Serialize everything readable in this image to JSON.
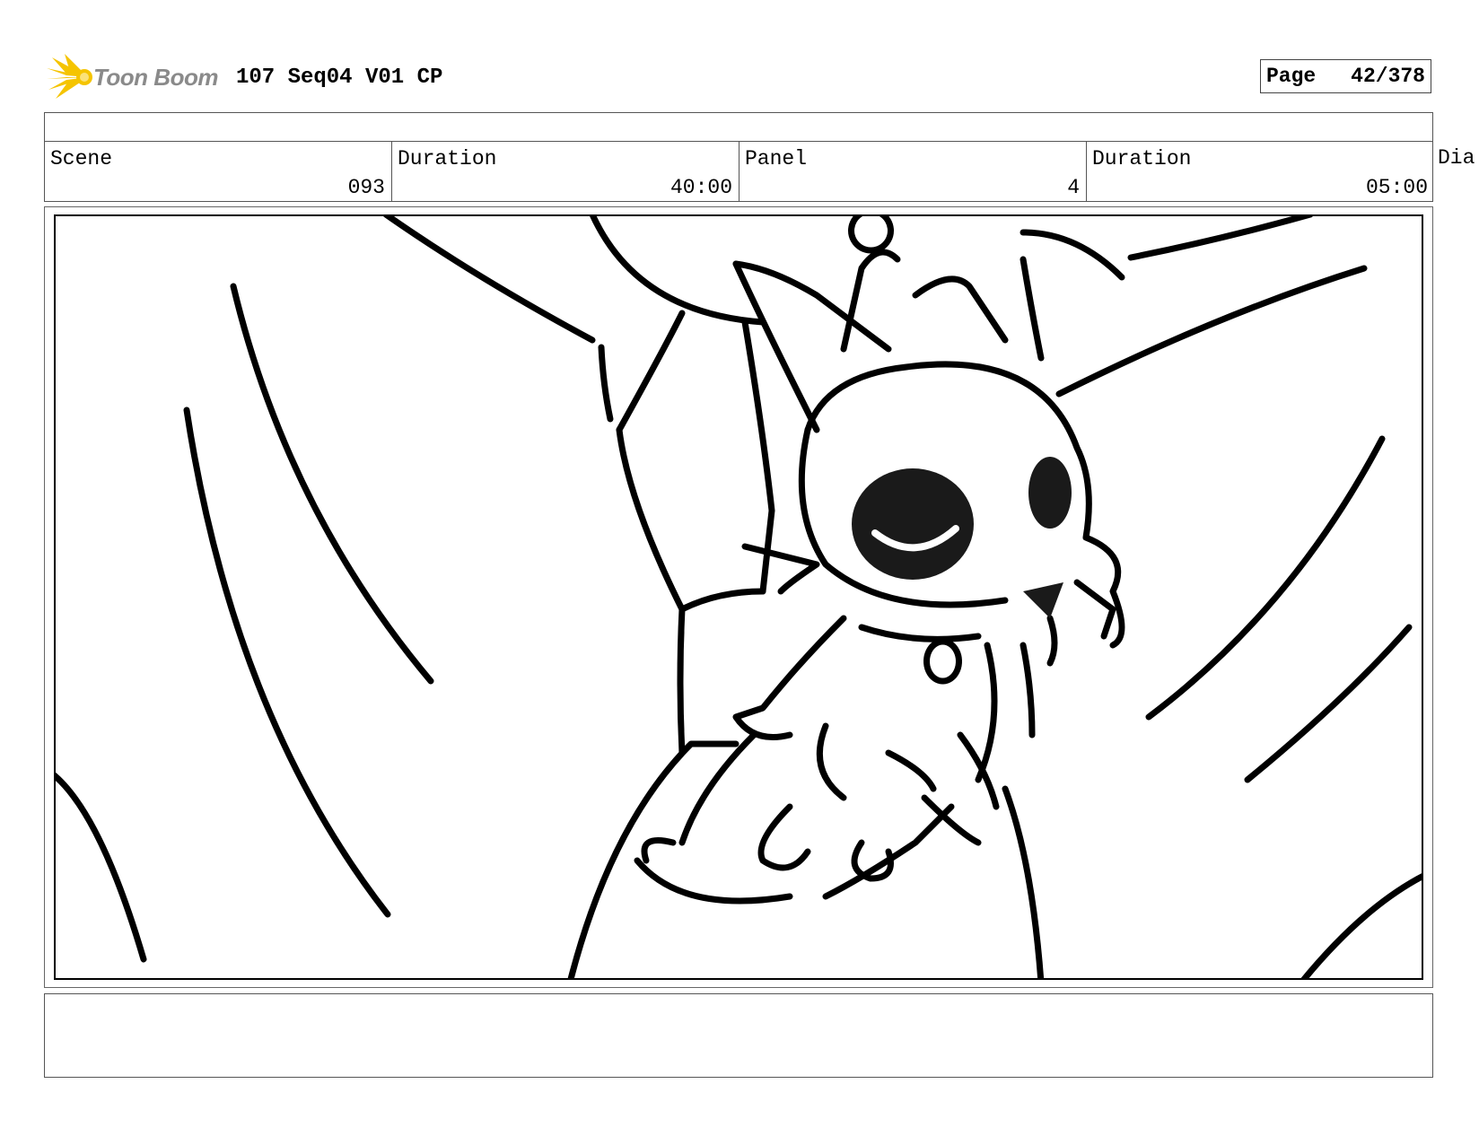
{
  "logo": {
    "text": "Toon Boom",
    "mark_icon": "sunburst-icon",
    "mark_color": "#f5c400",
    "text_color": "#8a8a8a"
  },
  "document": {
    "title": "107 Seq04 V01 CP"
  },
  "page_indicator": {
    "label": "Page",
    "value": "42/378"
  },
  "info": {
    "scene": {
      "label": "Scene",
      "value": "093"
    },
    "scene_duration": {
      "label": "Duration",
      "value": "40:00"
    },
    "panel": {
      "label": "Panel",
      "value": "4"
    },
    "panel_duration": {
      "label": "Duration",
      "value": "05:00"
    },
    "dialogue": {
      "label": "Dia"
    }
  },
  "panel_image": {
    "subject": "storyboard-sketch"
  },
  "dialogue": {
    "text": ""
  }
}
